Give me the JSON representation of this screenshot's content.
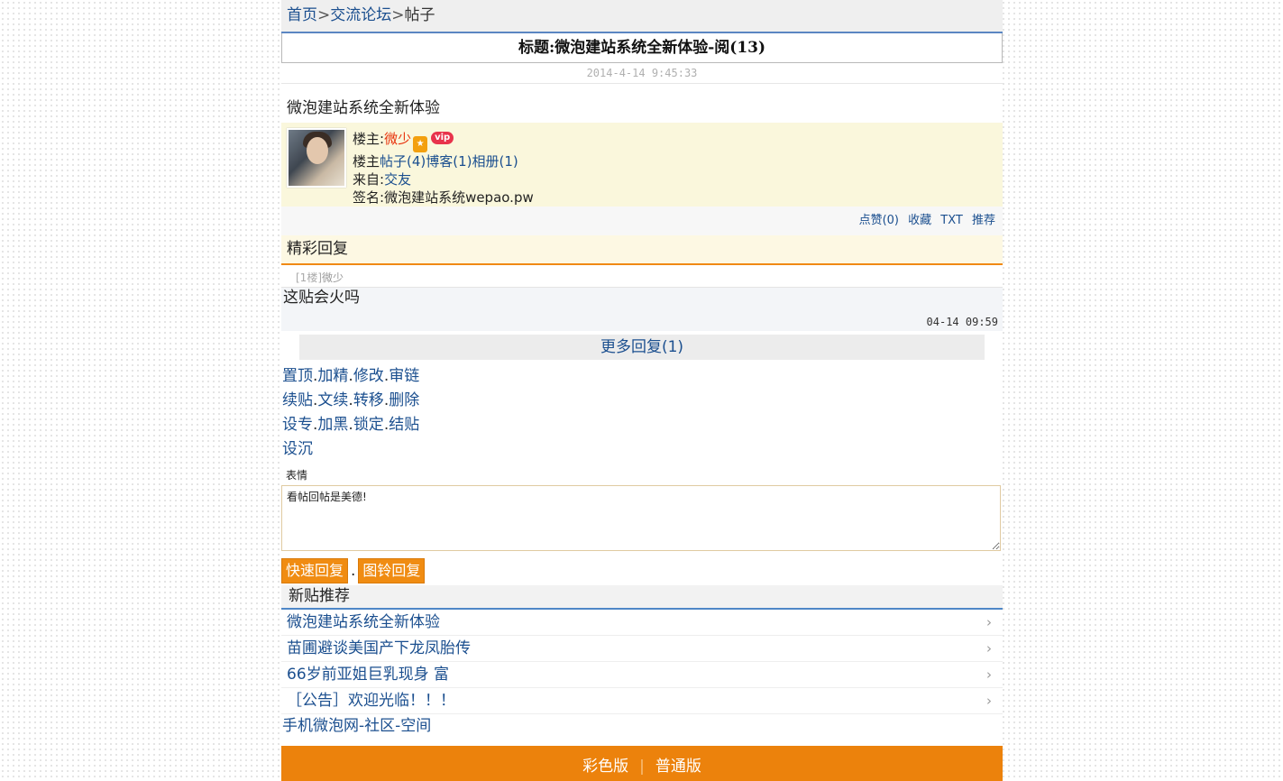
{
  "breadcrumb": {
    "home": "首页",
    "forum": "交流论坛",
    "current": "帖子",
    "sep": ">"
  },
  "post": {
    "title": "标题:微泡建站系统全新体验-阅(13)",
    "date": "2014-4-14 9:45:33",
    "body": "微泡建站系统全新体验"
  },
  "owner": {
    "label": "楼主:",
    "name": "微少",
    "vip": "vip",
    "links_label": "楼主",
    "posts": "帖子(4)",
    "blog": "博客(1)",
    "album": "相册(1)",
    "from_label": "来自:",
    "from": "交友",
    "sign_label": "签名:",
    "sign": "微泡建站系统wepao.pw"
  },
  "actions": {
    "like": "点赞(0)",
    "fav": "收藏",
    "txt": "TXT",
    "recommend": "推荐"
  },
  "best_reply": "精彩回复",
  "reply": {
    "floor": "[1楼]",
    "user": "微少",
    "text": "这贴会火吗",
    "time": "04-14 09:59"
  },
  "more_replies": "更多回复(1)",
  "admin": {
    "r1": [
      "置顶",
      "加精",
      "修改",
      "审链"
    ],
    "r2": [
      "续贴",
      "文续",
      "转移",
      "删除"
    ],
    "r3": [
      "设专",
      "加黑",
      "锁定",
      "结贴"
    ],
    "r4": [
      "设沉"
    ],
    "dot": "."
  },
  "emoji_label": "表情",
  "reply_box": {
    "value": "看帖回帖是美德!"
  },
  "buttons": {
    "quick": "快速回复",
    "dot": ".",
    "image": "图铃回复"
  },
  "new_posts": {
    "header": "新贴推荐",
    "items": [
      "微泡建站系统全新体验",
      "苗圃避谈美国产下龙凤胎传",
      "66岁前亚姐巨乳现身 富",
      "［公告］欢迎光临！！！"
    ]
  },
  "footer_link": "手机微泡网-社区-空间",
  "footer": {
    "color": "彩色版",
    "sep": "|",
    "plain": "普通版"
  },
  "colors": {
    "accent": "#ec820c",
    "link": "#1b4f8f",
    "owner_name": "#e8330d"
  }
}
